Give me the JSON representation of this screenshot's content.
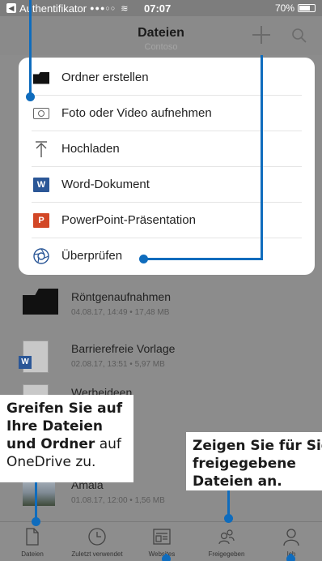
{
  "status_bar": {
    "carrier": "Authentifikator",
    "time": "07:07",
    "battery": "70%"
  },
  "nav": {
    "title": "Dateien",
    "subtitle": "Contoso"
  },
  "menu": {
    "items": [
      {
        "label": "Ordner erstellen",
        "icon": "folder-icon"
      },
      {
        "label": "Foto oder Video aufnehmen",
        "icon": "camera-icon"
      },
      {
        "label": "Hochladen",
        "icon": "upload-icon"
      },
      {
        "label": "Word-Dokument",
        "icon": "word-icon"
      },
      {
        "label": "PowerPoint-Präsentation",
        "icon": "powerpoint-icon"
      },
      {
        "label": "Überprüfen",
        "icon": "scan-icon"
      }
    ]
  },
  "files": [
    {
      "name": "Röntgenaufnahmen",
      "meta": "04.08.17, 14:49 • 17,48 MB",
      "type": "folder"
    },
    {
      "name": "Barrierefreie Vorlage",
      "meta": "02.08.17, 13:51 • 5,97 MB",
      "type": "word"
    },
    {
      "name": "Werbeideen",
      "meta": "",
      "type": "doc"
    },
    {
      "name": "Amala",
      "meta": "01.08.17, 12:00 • 1,56 MB",
      "type": "photo"
    }
  ],
  "tabs": [
    {
      "label": "Dateien",
      "icon": "files-icon"
    },
    {
      "label": "Zuletzt verwendet",
      "icon": "clock-icon"
    },
    {
      "label": "Websites",
      "icon": "websites-icon"
    },
    {
      "label": "Freigegeben",
      "icon": "shared-icon"
    },
    {
      "label": "Ich",
      "icon": "person-icon"
    }
  ],
  "callouts": {
    "left": {
      "bold": "Greifen Sie auf Ihre Dateien und Ordner",
      "rest": " auf OneDrive zu."
    },
    "right": {
      "bold": "Zeigen Sie für Sie freigegebene Dateien an."
    }
  },
  "colors": {
    "accent": "#0f6cbd",
    "word": "#2b5797",
    "powerpoint": "#d24726"
  }
}
